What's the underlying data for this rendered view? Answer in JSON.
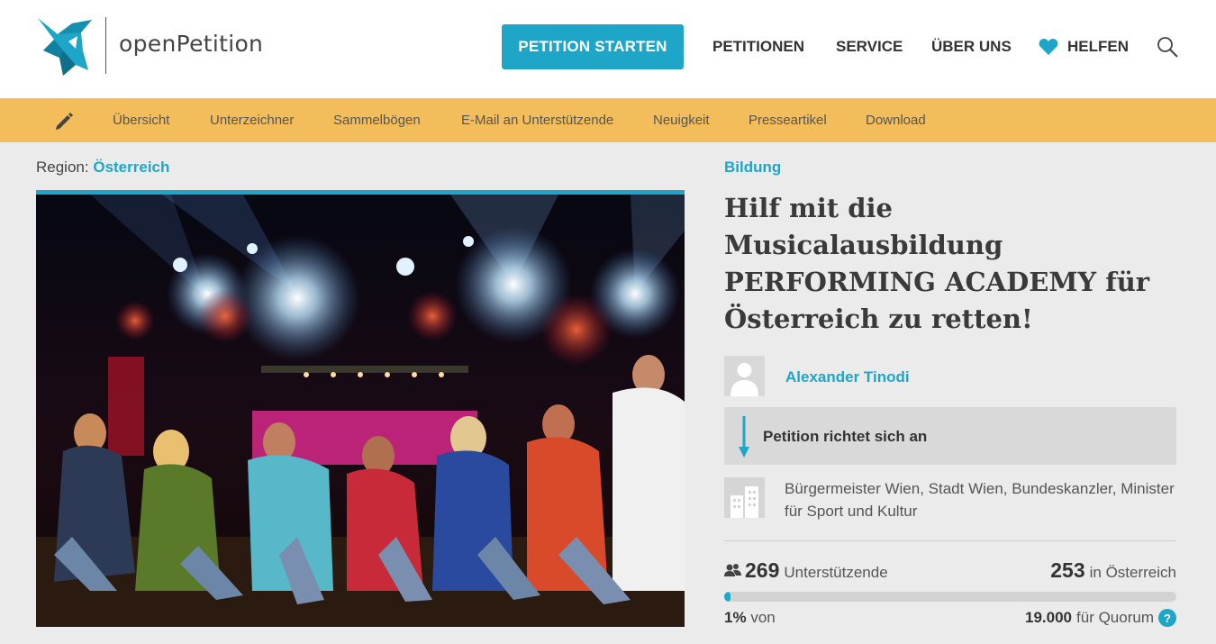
{
  "header": {
    "logo_text": "openPetition",
    "start_button": "PETITION STARTEN",
    "nav": [
      "PETITIONEN",
      "SERVICE",
      "ÜBER UNS",
      "HELFEN"
    ],
    "icons": {
      "logo": "dove-logo-icon",
      "heart": "heart-icon",
      "search": "search-icon"
    }
  },
  "subnav": {
    "icon": "pencil-icon",
    "items": [
      "Übersicht",
      "Unterzeichner",
      "Sammelbögen",
      "E-Mail an Unterstützende",
      "Neuigkeit",
      "Presseartikel",
      "Download"
    ]
  },
  "region": {
    "label": "Region:",
    "value": "Österreich"
  },
  "petition": {
    "category": "Bildung",
    "title": "Hilf mit die Musicalausbildung PERFORMING ACADEMY für Österreich zu retten!",
    "author": "Alexander Tinodi",
    "target_label": "Petition richtet sich an",
    "recipients": "Bürgermeister Wien, Stadt Wien, Bundeskanzler, Minister für Sport und Kultur"
  },
  "stats": {
    "supporters": "269",
    "supporters_label": "Unterstützende",
    "country_count": "253",
    "country_label": "in Österreich",
    "percent": "1%",
    "percent_suffix": "von",
    "quorum": "19.000",
    "quorum_label": "für Quorum",
    "progress_fraction": 0.014,
    "help_symbol": "?"
  },
  "colors": {
    "accent": "#1ea6c9",
    "subnav": "#f4bd5b",
    "background": "#ebebeb"
  }
}
